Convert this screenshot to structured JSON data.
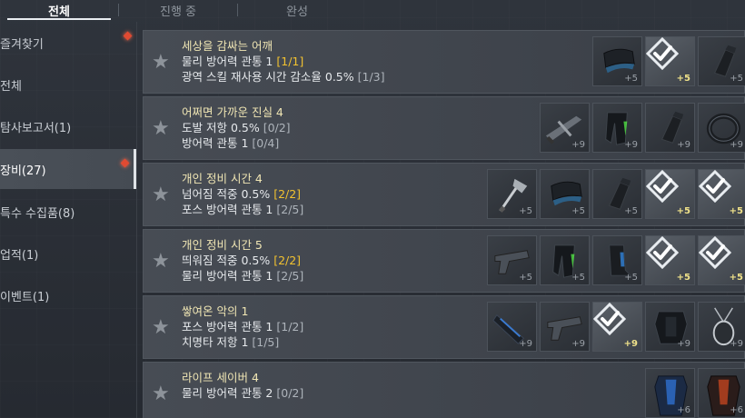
{
  "tabs": [
    {
      "label": "전체",
      "active": true
    },
    {
      "label": "진행 중",
      "active": false
    },
    {
      "label": "완성",
      "active": false
    }
  ],
  "sidebar": {
    "items": [
      {
        "label": "즐겨찾기",
        "badge": true,
        "active": false
      },
      {
        "label": "전체",
        "badge": false,
        "active": false
      },
      {
        "label": "탐사보고서(1)",
        "badge": false,
        "active": false
      },
      {
        "label": "장비(27)",
        "badge": true,
        "active": true
      },
      {
        "label": "특수 수집품(8)",
        "badge": false,
        "active": false
      },
      {
        "label": "업적(1)",
        "badge": false,
        "active": false
      },
      {
        "label": "이벤트(1)",
        "badge": false,
        "active": false
      }
    ]
  },
  "colors": {
    "title": "#f0e6b4",
    "progress_complete": "#f2c230",
    "badge": "#e04a32"
  },
  "rows": [
    {
      "title": "세상을 감싸는 어깨",
      "lines": [
        {
          "text": "물리 방어력 관통 1 ",
          "progress": "[1/1]",
          "complete": true
        },
        {
          "text": "광역 스킬 재사용 시간 감소율 0.5% ",
          "progress": "[1/3]",
          "complete": false
        }
      ],
      "items": [
        {
          "icon": "shoulder-icon",
          "enh": "+5",
          "done": false
        },
        {
          "icon": "check-icon",
          "enh": "+5",
          "done": true
        },
        {
          "icon": "gauntlet-icon",
          "enh": "+5",
          "done": false
        }
      ]
    },
    {
      "title": "어쩌면 가까운 진실 4",
      "lines": [
        {
          "text": "도발 저항 0.5% ",
          "progress": "[0/2]",
          "complete": false
        },
        {
          "text": "방어력 관통 1 ",
          "progress": "[0/4]",
          "complete": false
        }
      ],
      "items": [
        {
          "icon": "crossbow-icon",
          "enh": "+9",
          "done": false
        },
        {
          "icon": "legguard-icon",
          "enh": "+9",
          "done": false
        },
        {
          "icon": "gauntlet-icon",
          "enh": "+9",
          "done": false
        },
        {
          "icon": "ring-icon",
          "enh": "+9",
          "done": false
        }
      ]
    },
    {
      "title": "개인 정비 시간 4",
      "lines": [
        {
          "text": "넘어짐 적중 0.5% ",
          "progress": "[2/2]",
          "complete": true
        },
        {
          "text": "포스 방어력 관통 1 ",
          "progress": "[2/5]",
          "complete": false
        }
      ],
      "items": [
        {
          "icon": "axe-icon",
          "enh": "+5",
          "done": false
        },
        {
          "icon": "shoulder-icon",
          "enh": "+5",
          "done": false
        },
        {
          "icon": "gauntlet-icon",
          "enh": "+5",
          "done": false
        },
        {
          "icon": "check-icon",
          "enh": "+5",
          "done": true
        },
        {
          "icon": "check-icon",
          "enh": "+5",
          "done": true
        }
      ]
    },
    {
      "title": "개인 정비 시간 5",
      "lines": [
        {
          "text": "띄워짐 적중 0.5% ",
          "progress": "[2/2]",
          "complete": true
        },
        {
          "text": "물리 방어력 관통 1 ",
          "progress": "[2/5]",
          "complete": false
        }
      ],
      "items": [
        {
          "icon": "pistol-icon",
          "enh": "+5",
          "done": false
        },
        {
          "icon": "legguard-icon",
          "enh": "+5",
          "done": false
        },
        {
          "icon": "boots-icon",
          "enh": "+5",
          "done": false
        },
        {
          "icon": "check-icon",
          "enh": "+5",
          "done": true
        },
        {
          "icon": "check-icon",
          "enh": "+5",
          "done": true
        }
      ]
    },
    {
      "title": "쌓여온 악의 1",
      "lines": [
        {
          "text": "포스 방어력 관통 1 ",
          "progress": "[1/2]",
          "complete": false
        },
        {
          "text": "치명타 저항 1 ",
          "progress": "[1/5]",
          "complete": false
        }
      ],
      "items": [
        {
          "icon": "gloves-icon",
          "enh": "+9",
          "done": false
        },
        {
          "icon": "pistol-icon",
          "enh": "+9",
          "done": false
        },
        {
          "icon": "check-icon",
          "enh": "+9",
          "done": true
        },
        {
          "icon": "armor-icon",
          "enh": "+9",
          "done": false
        },
        {
          "icon": "amulet-icon",
          "enh": "+9",
          "done": false
        }
      ]
    },
    {
      "title": "라이프 세이버 4",
      "lines": [
        {
          "text": "물리 방어력 관통 2 ",
          "progress": "[0/2]",
          "complete": false
        }
      ],
      "items": [
        {
          "icon": "bodysuit-icon",
          "enh": "+6",
          "done": false
        },
        {
          "icon": "bodysuit-red-icon",
          "enh": "+6",
          "done": false
        }
      ]
    }
  ]
}
